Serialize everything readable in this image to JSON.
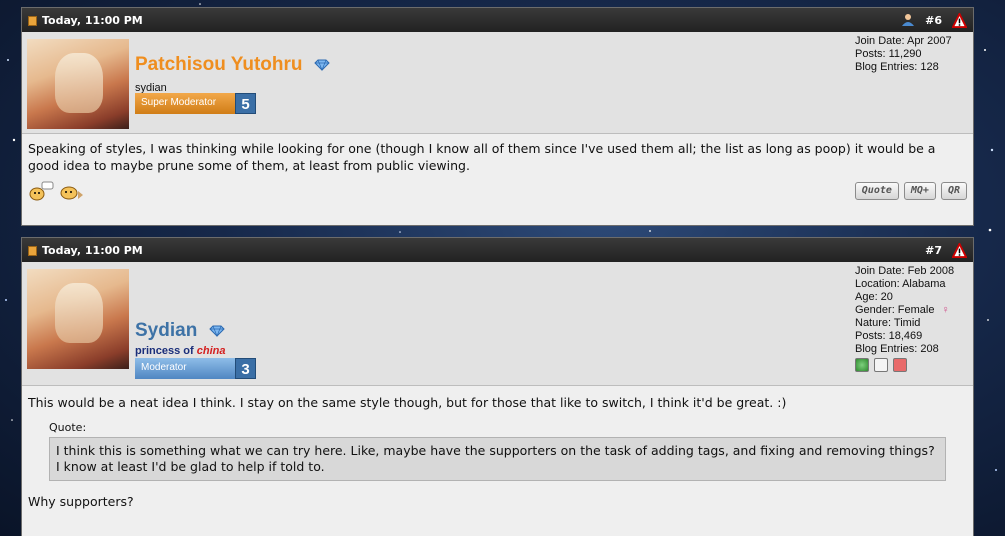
{
  "posts": [
    {
      "date": "Today, 11:00 PM",
      "number": "#6",
      "username": "Patchisou Yutohru",
      "username_color": "#ef8e1f",
      "user_title_parts": [
        {
          "text": "sydian"
        }
      ],
      "rank_label": "Super Moderator",
      "rank_color": "#e39122",
      "rank_level": "5",
      "stats": [
        "Join Date: Apr 2007",
        "Posts: 11,290",
        "Blog Entries: 128"
      ],
      "message": "Speaking of styles, I was thinking while looking for one (though I know all of them since I've used them all; the list as long as poop) it would be a good idea to maybe prune some of them, at least from public viewing.",
      "buttons": [
        "Quote",
        "MQ+",
        "QR"
      ]
    },
    {
      "date": "Today, 11:00 PM",
      "number": "#7",
      "username": "Sydian",
      "username_color": "#3d72a6",
      "user_title_prefix": "princess of",
      "user_title_em": "china",
      "rank_label": "Moderator",
      "rank_color": "#6a9fd4",
      "rank_level": "3",
      "stats": [
        "Join Date: Feb 2008",
        "Location: Alabama",
        "Age: 20",
        "Gender: Female",
        "Nature: Timid",
        "Posts: 18,469",
        "Blog Entries: 208"
      ],
      "message": "This would be a neat idea I think. I stay on the same style though, but for those that like to switch, I think it'd be great. :)",
      "quote_label": "Quote:",
      "quote_text": "I think this is something what we can try here. Like, maybe have the supporters on the task of adding tags, and fixing and removing things? I know at least I'd be glad to help if told to.",
      "message2": "Why supporters?"
    }
  ]
}
